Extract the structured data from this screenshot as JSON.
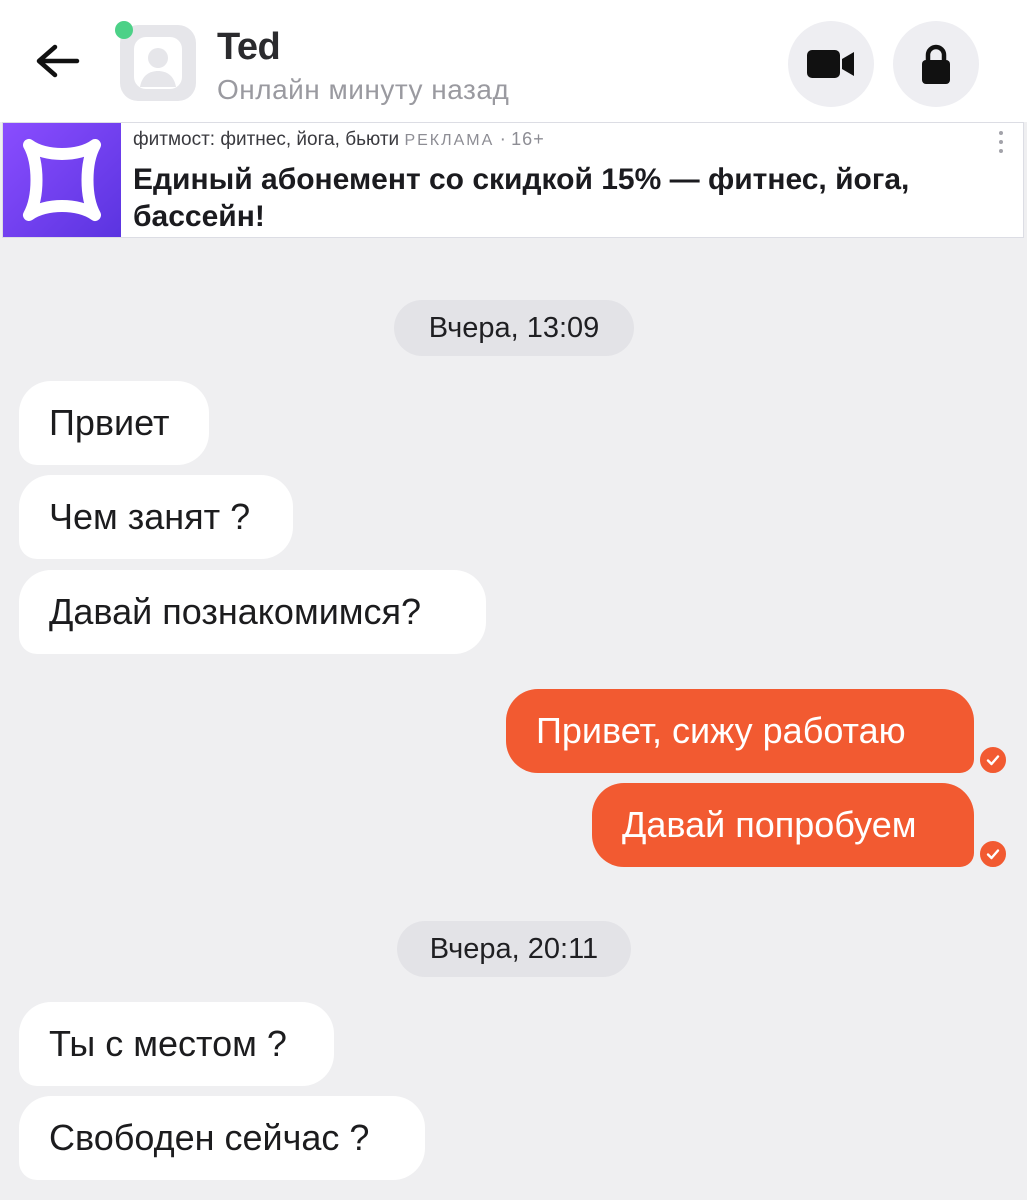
{
  "header": {
    "contact_name": "Ted",
    "status": "Онлайн минуту назад",
    "icons": {
      "back": "arrow-left-icon",
      "video": "video-camera-icon",
      "lock": "lock-icon",
      "avatar": "user-placeholder-icon"
    },
    "online_color": "#4cd187"
  },
  "ad": {
    "advertiser": "фитмост: фитнес, йога, бьюти",
    "label": "РЕКЛАМА",
    "separator": "·",
    "age": "16+",
    "title": "Единый абонемент со скидкой 15% — фитнес, йога, бассейн!",
    "brand_color": "#6b3cf0"
  },
  "chat": {
    "accent": "#f25a31",
    "groups": [
      {
        "date": "Вчера, 13:09",
        "messages": [
          {
            "direction": "in",
            "text": "Првиет"
          },
          {
            "direction": "in",
            "text": "Чем занят ?"
          },
          {
            "direction": "in",
            "text": "Давай познакомимся?"
          },
          {
            "direction": "out",
            "text": "Привет, сижу работаю"
          },
          {
            "direction": "out",
            "text": "Давай попробуем"
          }
        ]
      },
      {
        "date": "Вчера, 20:11",
        "messages": [
          {
            "direction": "in",
            "text": "Ты с местом ?"
          },
          {
            "direction": "in",
            "text": "Свободен сейчас ?"
          }
        ]
      }
    ]
  }
}
